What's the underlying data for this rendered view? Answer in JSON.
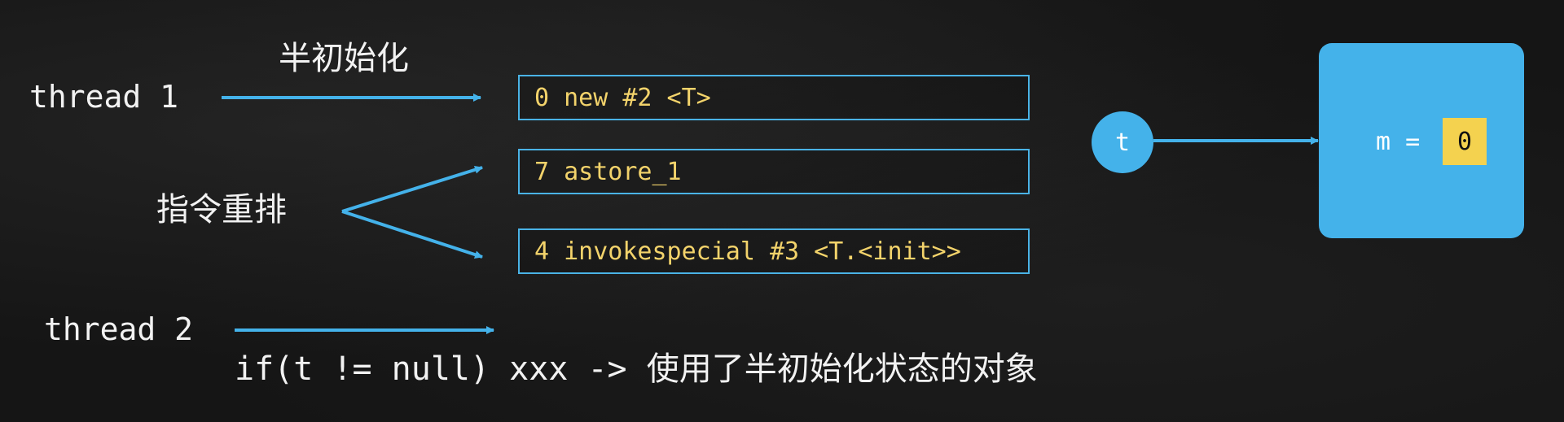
{
  "labels": {
    "thread1": "thread 1",
    "thread2": "thread 2",
    "half_init": "半初始化",
    "reorder": "指令重排",
    "code": "if(t != null) xxx -> 使用了半初始化状态的对象"
  },
  "instructions": [
    "0 new #2 <T>",
    "7 astore_1",
    "4 invokespecial #3 <T.<init>>"
  ],
  "reference": {
    "name": "t"
  },
  "object": {
    "field_label": "m =",
    "field_value": "0"
  },
  "colors": {
    "background": "#151515",
    "accent_blue": "#44b2ea",
    "instruction_text": "#f3d36b",
    "highlight_yellow": "#f4d24f"
  }
}
